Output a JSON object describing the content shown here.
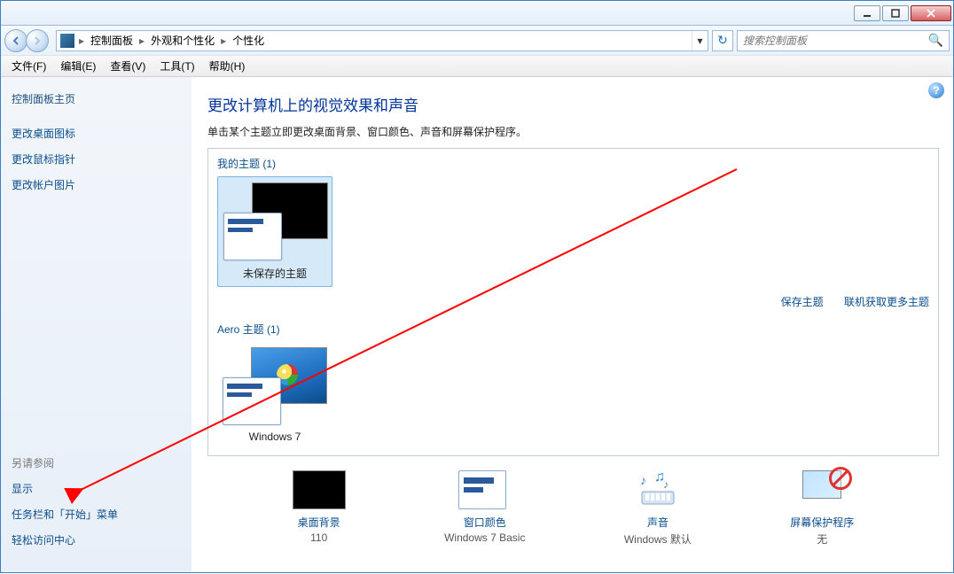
{
  "breadcrumb": {
    "seg1": "控制面板",
    "seg2": "外观和个性化",
    "seg3": "个性化"
  },
  "search": {
    "placeholder": "搜索控制面板"
  },
  "menu": {
    "file": "文件(F)",
    "edit": "编辑(E)",
    "view": "查看(V)",
    "tools": "工具(T)",
    "help": "帮助(H)"
  },
  "sidebar": {
    "home": "控制面板主页",
    "links": [
      "更改桌面图标",
      "更改鼠标指针",
      "更改帐户图片"
    ],
    "seealso": "另请参阅",
    "footer": [
      "显示",
      "任务栏和「开始」菜单",
      "轻松访问中心"
    ]
  },
  "main": {
    "title": "更改计算机上的视觉效果和声音",
    "subtitle": "单击某个主题立即更改桌面背景、窗口颜色、声音和屏幕保护程序。",
    "my_themes_label": "我的主题 (1)",
    "aero_themes_label": "Aero 主题 (1)",
    "unsaved_theme": "未保存的主题",
    "win7_theme": "Windows 7",
    "save_theme": "保存主题",
    "get_more": "联机获取更多主题"
  },
  "bottom": {
    "bg": {
      "label": "桌面背景",
      "value": "110"
    },
    "color": {
      "label": "窗口颜色",
      "value": "Windows 7 Basic"
    },
    "sound": {
      "label": "声音",
      "value": "Windows 默认"
    },
    "ss": {
      "label": "屏幕保护程序",
      "value": "无"
    }
  }
}
